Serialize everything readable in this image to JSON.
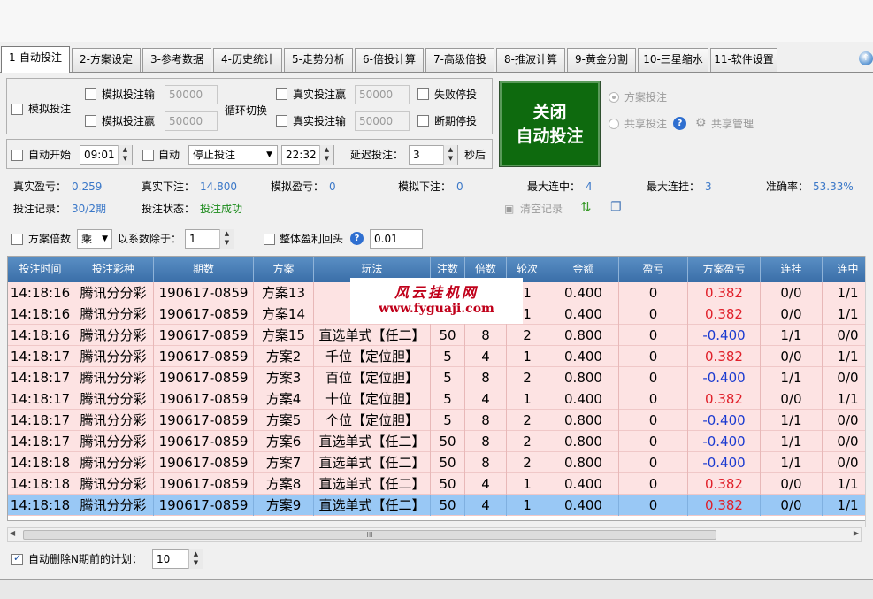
{
  "tabs": [
    {
      "label": "1-自动投注",
      "active": true
    },
    {
      "label": "2-方案设定"
    },
    {
      "label": "3-参考数据"
    },
    {
      "label": "4-历史统计"
    },
    {
      "label": "5-走势分析"
    },
    {
      "label": "6-倍投计算"
    },
    {
      "label": "7-高级倍投"
    },
    {
      "label": "8-推波计算"
    },
    {
      "label": "9-黄金分割"
    },
    {
      "label": "10-三星缩水"
    },
    {
      "label": "11-软件设置"
    }
  ],
  "controls": {
    "sim_bet": "模拟投注",
    "sim_loss": "模拟投注输",
    "sim_loss_value": "50000",
    "sim_win": "模拟投注赢",
    "sim_win_value": "50000",
    "cycle_switch": "循环切换",
    "real_win": "真实投注赢",
    "real_win_value": "50000",
    "real_loss": "真实投注输",
    "real_loss_value": "50000",
    "fail_stop": "失败停投",
    "break_stop": "断期停投",
    "big_button_line1": "关闭",
    "big_button_line2": "自动投注",
    "plan_bet": "方案投注",
    "share_bet": "共享投注",
    "share_manage": "共享管理",
    "auto_start": "自动开始",
    "start_time": "09:01",
    "auto": "自动",
    "stop_select": "停止投注",
    "end_time": "22:32",
    "delay_label": "延迟投注：",
    "delay_value": "3",
    "seconds": "秒后"
  },
  "stats": {
    "real_profit_label": "真实盈亏：",
    "real_profit": "0.259",
    "real_bet_label": "真实下注：",
    "real_bet": "14.800",
    "sim_profit_label": "模拟盈亏：",
    "sim_profit": "0",
    "sim_bet_label": "模拟下注：",
    "sim_bet": "0",
    "max_hits_label": "最大连中：",
    "max_hits": "4",
    "max_miss_label": "最大连挂：",
    "max_miss": "3",
    "accuracy_label": "准确率：",
    "accuracy": "53.33%",
    "record_label": "投注记录：",
    "record": "30/2期",
    "status_label": "投注状态：",
    "status": "投注成功",
    "clear_record": "清空记录"
  },
  "options": {
    "plan_multiplier": "方案倍数",
    "op": "乘",
    "divide_label": "以系数除于：",
    "divide_value": "1",
    "overall_return": "整体盈利回头",
    "return_value": "0.01"
  },
  "watermark": {
    "line1": "风云挂机网",
    "line2": "www.fyguaji.com"
  },
  "table": {
    "columns": [
      "投注时间",
      "投注彩种",
      "期数",
      "方案",
      "玩法",
      "注数",
      "倍数",
      "轮次",
      "金额",
      "盈亏",
      "方案盈亏",
      "连挂",
      "连中"
    ],
    "rows": [
      {
        "cells": [
          "14:18:16",
          "腾讯分分彩",
          "190617-0859",
          "方案13",
          "直选单",
          "",
          "",
          "1",
          "0.400",
          "0",
          "0.382",
          "0/0",
          "1/1"
        ],
        "neg": false
      },
      {
        "cells": [
          "14:18:16",
          "腾讯分分彩",
          "190617-0859",
          "方案14",
          "直选单",
          "",
          "",
          "1",
          "0.400",
          "0",
          "0.382",
          "0/0",
          "1/1"
        ],
        "neg": false
      },
      {
        "cells": [
          "14:18:16",
          "腾讯分分彩",
          "190617-0859",
          "方案15",
          "直选单式【任二】",
          "50",
          "8",
          "2",
          "0.800",
          "0",
          "-0.400",
          "1/1",
          "0/0"
        ],
        "neg": true
      },
      {
        "cells": [
          "14:18:17",
          "腾讯分分彩",
          "190617-0859",
          "方案2",
          "千位【定位胆】",
          "5",
          "4",
          "1",
          "0.400",
          "0",
          "0.382",
          "0/0",
          "1/1"
        ],
        "neg": false
      },
      {
        "cells": [
          "14:18:17",
          "腾讯分分彩",
          "190617-0859",
          "方案3",
          "百位【定位胆】",
          "5",
          "8",
          "2",
          "0.800",
          "0",
          "-0.400",
          "1/1",
          "0/0"
        ],
        "neg": true
      },
      {
        "cells": [
          "14:18:17",
          "腾讯分分彩",
          "190617-0859",
          "方案4",
          "十位【定位胆】",
          "5",
          "4",
          "1",
          "0.400",
          "0",
          "0.382",
          "0/0",
          "1/1"
        ],
        "neg": false
      },
      {
        "cells": [
          "14:18:17",
          "腾讯分分彩",
          "190617-0859",
          "方案5",
          "个位【定位胆】",
          "5",
          "8",
          "2",
          "0.800",
          "0",
          "-0.400",
          "1/1",
          "0/0"
        ],
        "neg": true
      },
      {
        "cells": [
          "14:18:17",
          "腾讯分分彩",
          "190617-0859",
          "方案6",
          "直选单式【任二】",
          "50",
          "8",
          "2",
          "0.800",
          "0",
          "-0.400",
          "1/1",
          "0/0"
        ],
        "neg": true
      },
      {
        "cells": [
          "14:18:18",
          "腾讯分分彩",
          "190617-0859",
          "方案7",
          "直选单式【任二】",
          "50",
          "8",
          "2",
          "0.800",
          "0",
          "-0.400",
          "1/1",
          "0/0"
        ],
        "neg": true
      },
      {
        "cells": [
          "14:18:18",
          "腾讯分分彩",
          "190617-0859",
          "方案8",
          "直选单式【任二】",
          "50",
          "4",
          "1",
          "0.400",
          "0",
          "0.382",
          "0/0",
          "1/1"
        ],
        "neg": false
      },
      {
        "cells": [
          "14:18:18",
          "腾讯分分彩",
          "190617-0859",
          "方案9",
          "直选单式【任二】",
          "50",
          "4",
          "1",
          "0.400",
          "0",
          "0.382",
          "0/0",
          "1/1"
        ],
        "neg": false,
        "selected": true
      }
    ]
  },
  "scroll_grip": "III",
  "footer": {
    "auto_delete": "自动删除N期前的计划：",
    "auto_delete_value": "10"
  },
  "colors": {
    "header": "#4a80b8",
    "row_bg": "#fde3e3",
    "selected_row": "#99c8f5",
    "positive": "#e0202a",
    "negative": "#1a3ad0",
    "button": "#0e6a0e"
  }
}
